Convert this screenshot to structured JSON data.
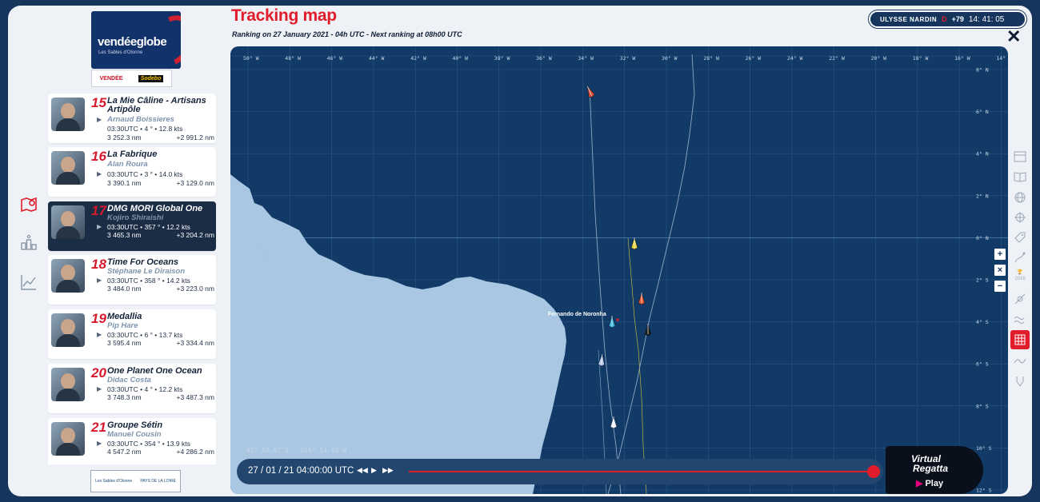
{
  "header": {
    "title": "Tracking map",
    "subtitle": "Ranking on 27 January 2021 - 04h UTC -  Next ranking at  08h00  UTC"
  },
  "logo": {
    "wordmark": "vendéeglobe",
    "tagline": "Les Sables d'Olonne",
    "partner1": "VENDÉE",
    "partner2": "Sodebo"
  },
  "clock": {
    "brand": "ULYSSE NARDIN",
    "d_label": "D",
    "days": "+79",
    "time": "14: 41: 05"
  },
  "skippers": [
    {
      "rank": "15",
      "boat": "La Mie Câline - Artisans Artipôle",
      "skipper": "Arnaud Boissieres",
      "stats": "03:30UTC • 4 ° • 12.8 kts",
      "dist": "3 252.3 nm",
      "gap": "+2 991.2 nm"
    },
    {
      "rank": "16",
      "boat": "La Fabrique",
      "skipper": "Alan Roura",
      "stats": "03:30UTC • 3 ° • 14.0 kts",
      "dist": "3 390.1 nm",
      "gap": "+3 129.0 nm"
    },
    {
      "rank": "17",
      "boat": "DMG MORI Global One",
      "skipper": "Kojiro Shiraishi",
      "stats": "03:30UTC • 357 ° • 12.2 kts",
      "dist": "3 465.3 nm",
      "gap": "+3 204.2 nm"
    },
    {
      "rank": "18",
      "boat": "Time For Oceans",
      "skipper": "Stéphane Le Diraison",
      "stats": "03:30UTC • 358 ° • 14.2 kts",
      "dist": "3 484.0 nm",
      "gap": "+3 223.0 nm"
    },
    {
      "rank": "19",
      "boat": "Medallia",
      "skipper": "Pip Hare",
      "stats": "03:30UTC • 6 ° • 13.7 kts",
      "dist": "3 595.4 nm",
      "gap": "+3 334.4 nm"
    },
    {
      "rank": "20",
      "boat": "One Planet One Ocean",
      "skipper": "Didac Costa",
      "stats": "03:30UTC • 4 ° • 12.2 kts",
      "dist": "3 748.3 nm",
      "gap": "+3 487.3 nm"
    },
    {
      "rank": "21",
      "boat": "Groupe Sétin",
      "skipper": "Manuel Cousin",
      "stats": "03:30UTC • 354 ° • 13.9 kts",
      "dist": "4 547.2 nm",
      "gap": "+4 286.2 nm"
    }
  ],
  "map": {
    "lon_labels": [
      "50° W",
      "48° W",
      "46° W",
      "44° W",
      "42° W",
      "40° W",
      "38° W",
      "36° W",
      "34° W",
      "32° W",
      "30° W",
      "28° W",
      "26° W",
      "24° W",
      "22° W",
      "20° W",
      "18° W",
      "16° W",
      "14°"
    ],
    "lat_labels": [
      "8° N",
      "6° N",
      "4° N",
      "2° N",
      "0° N",
      "2° S",
      "4° S",
      "6° S",
      "8° S",
      "10° S",
      "12° S"
    ],
    "place": "Fernando de Noronha",
    "cursor_coord": "02° 56.67'S - 016° 54.08'W",
    "colors": {
      "ocean": "#113a66",
      "land": "#a9c6e2",
      "accent": "#e11d2b"
    }
  },
  "timeline": {
    "date": "27 / 01 / 21  04:00:00 UTC",
    "prev_icon": "previous-icon",
    "play_icon": "play-icon",
    "next_icon": "next-icon",
    "progress": 1.0
  },
  "virtual_regatta": {
    "line1": "Virtual",
    "line2": "Regatta",
    "play": "Play"
  },
  "zoom": {
    "in": "+",
    "reset": "×",
    "out": "−"
  },
  "tools": {
    "year_label": "2016"
  },
  "footer": {
    "partner_left": "Les Sables d'Olonne",
    "partner_right": "PAYS DE LA LOIRE"
  }
}
